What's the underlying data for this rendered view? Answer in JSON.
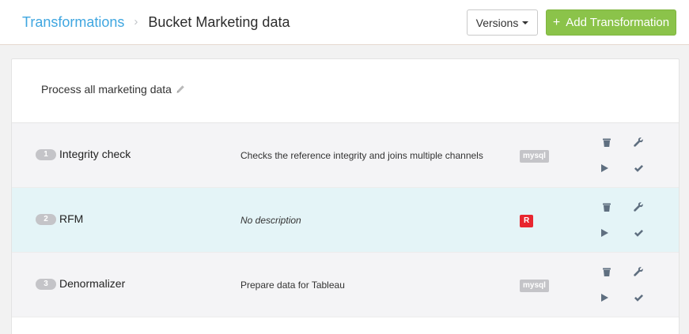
{
  "breadcrumb": {
    "parent": "Transformations",
    "separator": "›",
    "current": "Bucket Marketing data"
  },
  "toolbar": {
    "versions_label": "Versions",
    "add_label": "Add Transformation",
    "add_icon": "+"
  },
  "panel": {
    "title": "Process all marketing data"
  },
  "transformations": [
    {
      "number": "1",
      "name": "Integrity check",
      "description": "Checks the reference integrity and joins multiple channels",
      "backend": "mysql",
      "backend_color": "#c4c4c8"
    },
    {
      "number": "2",
      "name": "RFM",
      "description": "No description",
      "backend": "R",
      "backend_color": "#e8262f"
    },
    {
      "number": "3",
      "name": "Denormalizer",
      "description": "Prepare data for Tableau",
      "backend": "mysql",
      "backend_color": "#c4c4c8"
    }
  ],
  "colors": {
    "link": "#3fa6e0",
    "accent_green": "#8bc34a",
    "highlight_row": "#e4f4f7",
    "icon": "#5f6f80"
  },
  "icons": {
    "edit": "pencil-icon",
    "delete": "trash-icon",
    "configure": "wrench-icon",
    "run": "play-icon",
    "check": "checkmark-icon"
  }
}
